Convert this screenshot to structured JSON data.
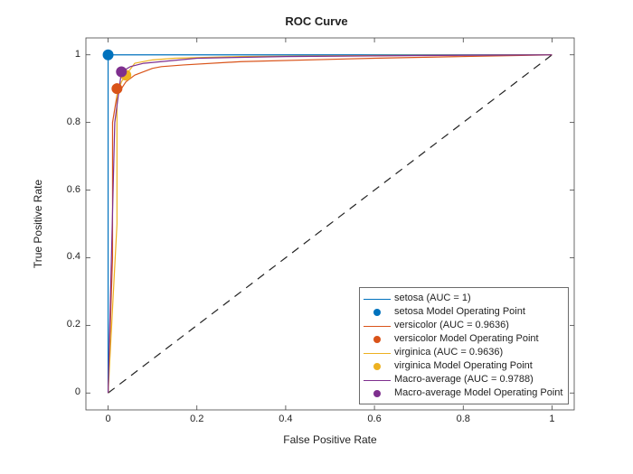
{
  "chart_data": {
    "type": "line",
    "title": "ROC Curve",
    "xlabel": "False Positive Rate",
    "ylabel": "True Positive Rate",
    "xlim": [
      -0.05,
      1.05
    ],
    "ylim": [
      -0.05,
      1.05
    ],
    "xticks": [
      0,
      0.2,
      0.4,
      0.6,
      0.8,
      1
    ],
    "yticks": [
      0,
      0.2,
      0.4,
      0.6,
      0.8,
      1
    ],
    "reference_line": {
      "x": [
        0,
        1
      ],
      "y": [
        0,
        1
      ],
      "style": "dashed"
    },
    "series": [
      {
        "name": "setosa (AUC = 1)",
        "color": "#0072BD",
        "x": [
          0,
          0.0,
          1
        ],
        "y": [
          0,
          1.0,
          1
        ],
        "op_label": "setosa Model Operating Point",
        "op_x": 0.0,
        "op_y": 1.0
      },
      {
        "name": "versicolor (AUC = 0.9636)",
        "color": "#D95319",
        "x": [
          0,
          0.01,
          0.01,
          0.02,
          0.03,
          0.04,
          0.06,
          0.08,
          0.1,
          0.12,
          0.17,
          0.3,
          0.6,
          1.0
        ],
        "y": [
          0,
          0.4,
          0.8,
          0.88,
          0.9,
          0.92,
          0.94,
          0.95,
          0.96,
          0.965,
          0.97,
          0.98,
          0.99,
          1.0
        ],
        "op_label": "versicolor Model Operating Point",
        "op_x": 0.02,
        "op_y": 0.9
      },
      {
        "name": "virginica (AUC = 0.9636)",
        "color": "#EDB120",
        "x": [
          0,
          0.02,
          0.02,
          0.03,
          0.04,
          0.06,
          0.08,
          0.1,
          0.15,
          0.3,
          0.6,
          1.0
        ],
        "y": [
          0,
          0.5,
          0.88,
          0.92,
          0.94,
          0.975,
          0.98,
          0.985,
          0.99,
          0.995,
          0.998,
          1.0
        ],
        "op_label": "virginica Model Operating Point",
        "op_x": 0.04,
        "op_y": 0.94
      },
      {
        "name": "Macro-average (AUC = 0.9788)",
        "color": "#7E2F8E",
        "x": [
          0,
          0.015,
          0.03,
          0.05,
          0.08,
          0.12,
          0.2,
          0.4,
          0.7,
          1.0
        ],
        "y": [
          0,
          0.8,
          0.95,
          0.965,
          0.975,
          0.98,
          0.99,
          0.995,
          0.998,
          1.0
        ],
        "op_label": "Macro-average Model Operating Point",
        "op_x": 0.03,
        "op_y": 0.95
      }
    ],
    "legend_position": "lower-right-inside"
  }
}
